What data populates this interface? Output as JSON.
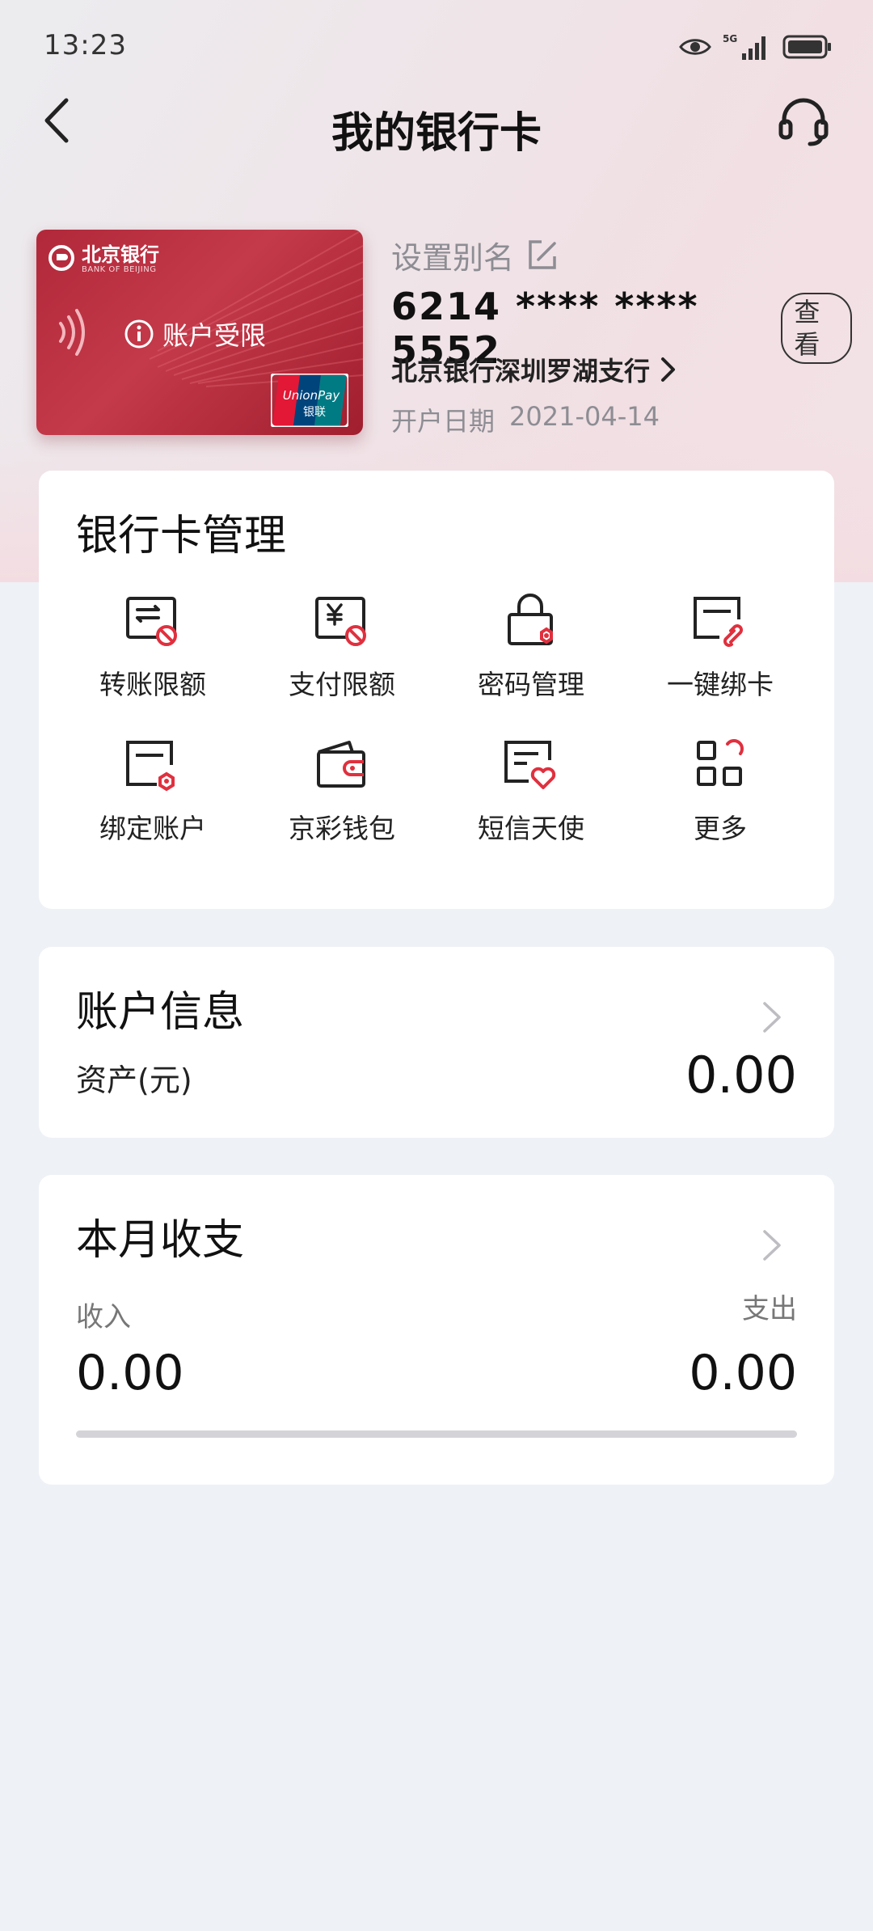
{
  "status_bar": {
    "time": "13:23",
    "network": "5G"
  },
  "header": {
    "title": "我的银行卡"
  },
  "card": {
    "bank_name": "北京银行",
    "bank_name_en": "BANK OF BEIJING",
    "status": "账户受限",
    "unionpay_en": "UnionPay",
    "unionpay_cn": "银联",
    "alias_label": "设置别名",
    "number": "6214 **** **** 5552",
    "view_label": "查看",
    "branch": "北京银行深圳罗湖支行",
    "open_date_label": "开户日期",
    "open_date": "2021-04-14"
  },
  "management": {
    "title": "银行卡管理",
    "items": [
      {
        "label": "转账限额",
        "icon": "transfer-limit-icon"
      },
      {
        "label": "支付限额",
        "icon": "payment-limit-icon"
      },
      {
        "label": "密码管理",
        "icon": "password-lock-icon"
      },
      {
        "label": "一键绑卡",
        "icon": "bind-card-icon"
      },
      {
        "label": "绑定账户",
        "icon": "bind-account-icon"
      },
      {
        "label": "京彩钱包",
        "icon": "wallet-icon"
      },
      {
        "label": "短信天使",
        "icon": "sms-icon"
      },
      {
        "label": "更多",
        "icon": "more-grid-icon"
      }
    ]
  },
  "account_info": {
    "title": "账户信息",
    "asset_label": "资产(元)",
    "asset_value": "0.00"
  },
  "monthly": {
    "title": "本月收支",
    "income_label": "收入",
    "income_value": "0.00",
    "expense_label": "支出",
    "expense_value": "0.00",
    "income_fraction": 0
  },
  "colors": {
    "brand_red": "#c4202f",
    "card_red": "#b1283a",
    "page_bg": "#eef1f6"
  }
}
